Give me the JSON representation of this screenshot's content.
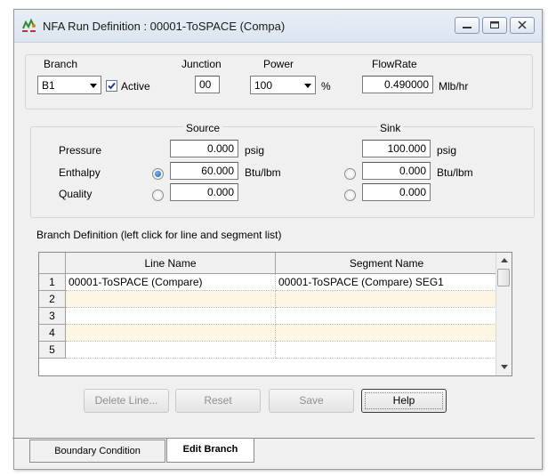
{
  "window": {
    "title": "NFA Run Definition : 00001-ToSPACE (Compa)"
  },
  "branch": {
    "label": "Branch",
    "value": "B1",
    "active_label": "Active",
    "active_checked": true,
    "junction_label": "Junction",
    "junction_value": "00",
    "power_label": "Power",
    "power_value": "100",
    "power_unit": "%",
    "flowrate_label": "FlowRate",
    "flowrate_value": "0.490000",
    "flowrate_unit": "Mlb/hr"
  },
  "conditions": {
    "source_label": "Source",
    "sink_label": "Sink",
    "rows": [
      {
        "label": "Pressure",
        "source": "0.000",
        "source_unit": "psig",
        "sink": "100.000",
        "sink_unit": "psig"
      },
      {
        "label": "Enthalpy",
        "source": "60.000",
        "source_unit": "Btu/lbm",
        "sink": "0.000",
        "sink_unit": "Btu/lbm",
        "source_radio_selected": true,
        "sink_radio_selected": false
      },
      {
        "label": "Quality",
        "source": "0.000",
        "source_unit": "",
        "sink": "0.000",
        "sink_unit": "",
        "source_radio_selected": false,
        "sink_radio_selected": false
      }
    ]
  },
  "branch_definition": {
    "label": "Branch Definition (left click for line and segment list)",
    "columns": [
      "Line Name",
      "Segment Name"
    ],
    "rows": [
      {
        "num": "1",
        "line": "00001-ToSPACE (Compare)",
        "segment": "00001-ToSPACE (Compare) SEG1"
      },
      {
        "num": "2",
        "line": "",
        "segment": ""
      },
      {
        "num": "3",
        "line": "",
        "segment": ""
      },
      {
        "num": "4",
        "line": "",
        "segment": ""
      },
      {
        "num": "5",
        "line": "",
        "segment": ""
      }
    ]
  },
  "buttons": {
    "delete_line": "Delete Line...",
    "reset": "Reset",
    "save": "Save",
    "help": "Help"
  },
  "tabs": [
    {
      "label": "Boundary Condition",
      "active": false
    },
    {
      "label": "Edit Branch",
      "active": true
    }
  ],
  "colors": {
    "accent": "#1b5aa6",
    "row_alt": "#fdf6e3",
    "window_bg": "#f0f0f0"
  },
  "icons": [
    "app-icon",
    "minimize-icon",
    "maximize-icon",
    "close-icon",
    "chevron-down-icon",
    "checkmark-icon",
    "scroll-up-icon",
    "scroll-down-icon"
  ]
}
